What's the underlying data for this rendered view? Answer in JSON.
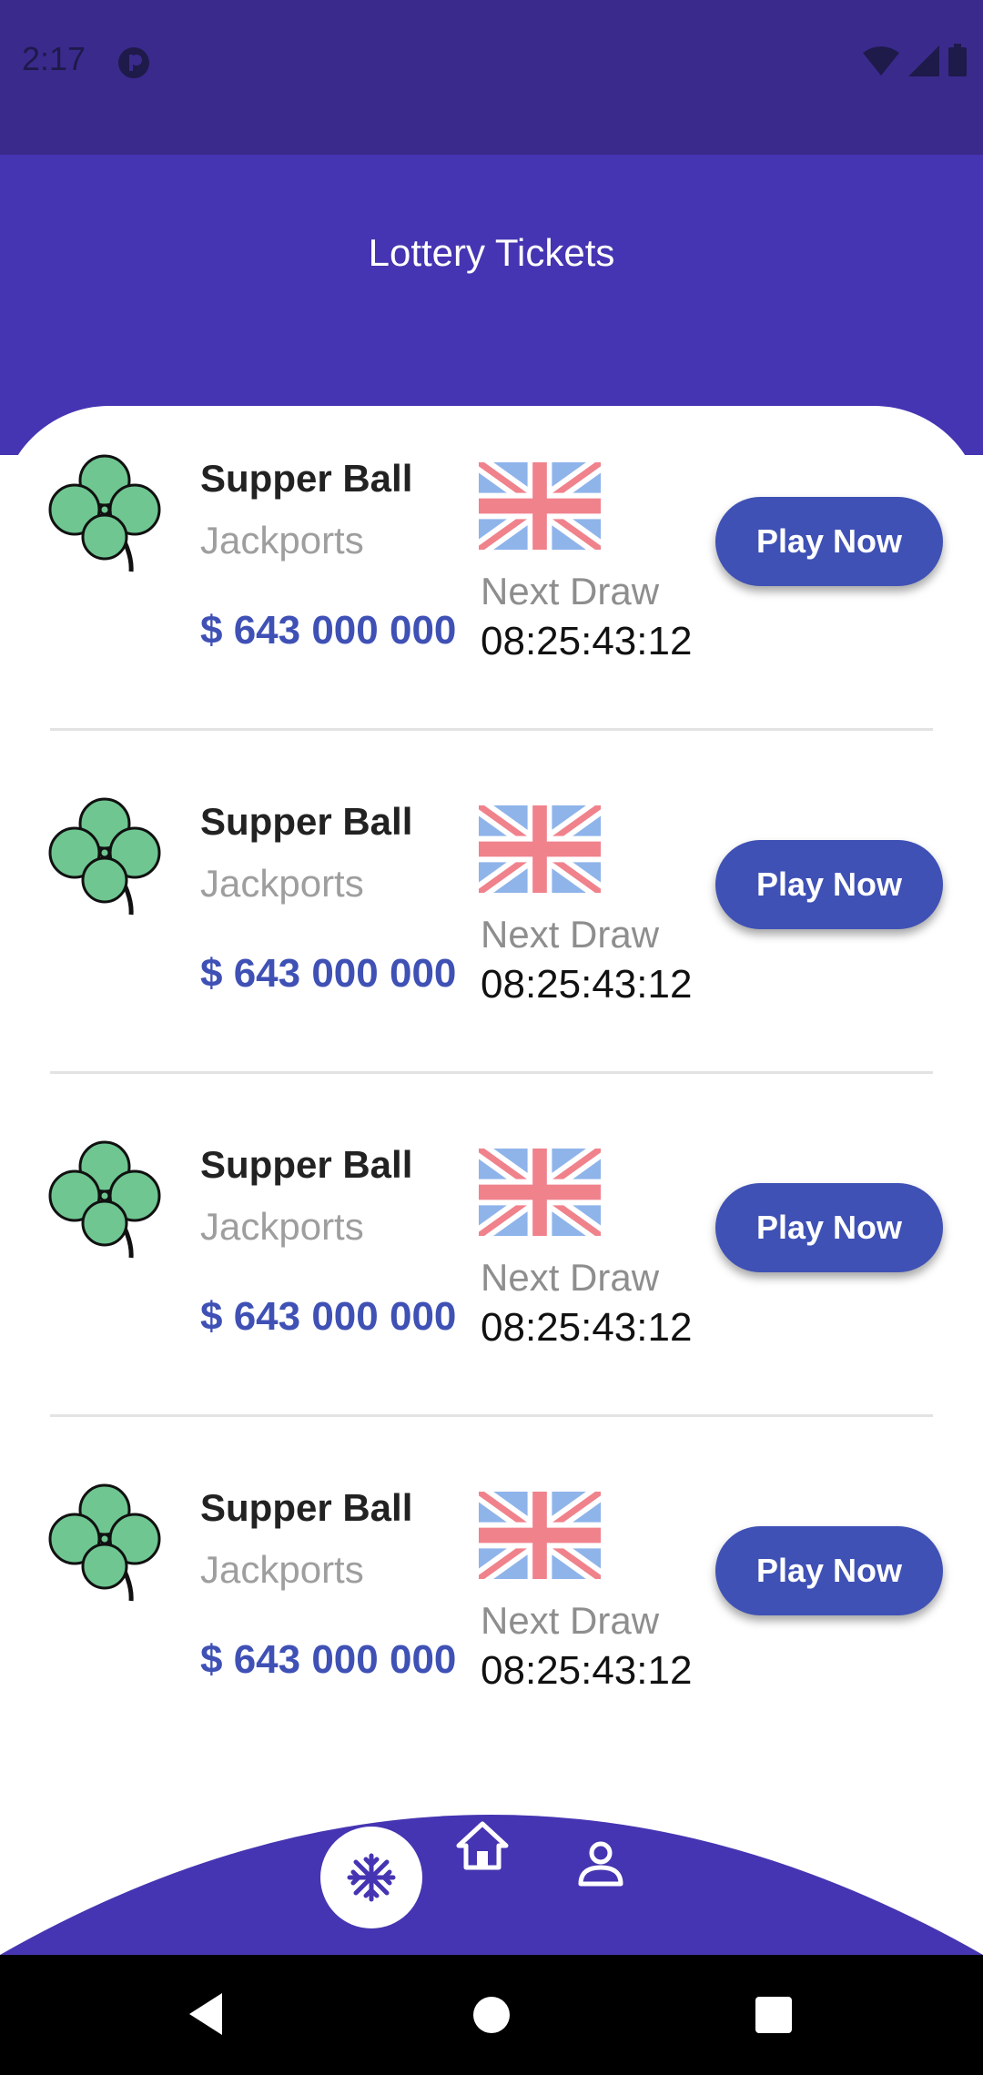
{
  "status_bar": {
    "time": "2:17"
  },
  "header": {
    "title": "Lottery Tickets"
  },
  "tickets": [
    {
      "name": "Supper Ball",
      "subtitle": "Jackports",
      "amount": "$ 643 000 000",
      "next_label": "Next Draw",
      "next_time": "08:25:43:12",
      "button": "Play Now"
    },
    {
      "name": "Supper Ball",
      "subtitle": "Jackports",
      "amount": "$ 643 000 000",
      "next_label": "Next Draw",
      "next_time": "08:25:43:12",
      "button": "Play Now"
    },
    {
      "name": "Supper Ball",
      "subtitle": "Jackports",
      "amount": "$ 643 000 000",
      "next_label": "Next Draw",
      "next_time": "08:25:43:12",
      "button": "Play Now"
    },
    {
      "name": "Supper Ball",
      "subtitle": "Jackports",
      "amount": "$ 643 000 000",
      "next_label": "Next Draw",
      "next_time": "08:25:43:12",
      "button": "Play Now"
    }
  ],
  "colors": {
    "status_bar": "#3a2a8c",
    "header": "#4535b2",
    "accent": "#3f51b5",
    "clover": "#6fc691"
  },
  "icons": {
    "status": [
      "app-indicator-icon",
      "wifi-icon",
      "signal-icon",
      "battery-icon"
    ],
    "ticket": [
      "clover-icon",
      "uk-flag-icon"
    ],
    "bottom_nav": [
      "snowflake-icon",
      "home-icon",
      "profile-icon"
    ],
    "system_nav": [
      "back-icon",
      "home-circle-icon",
      "recents-icon"
    ]
  }
}
